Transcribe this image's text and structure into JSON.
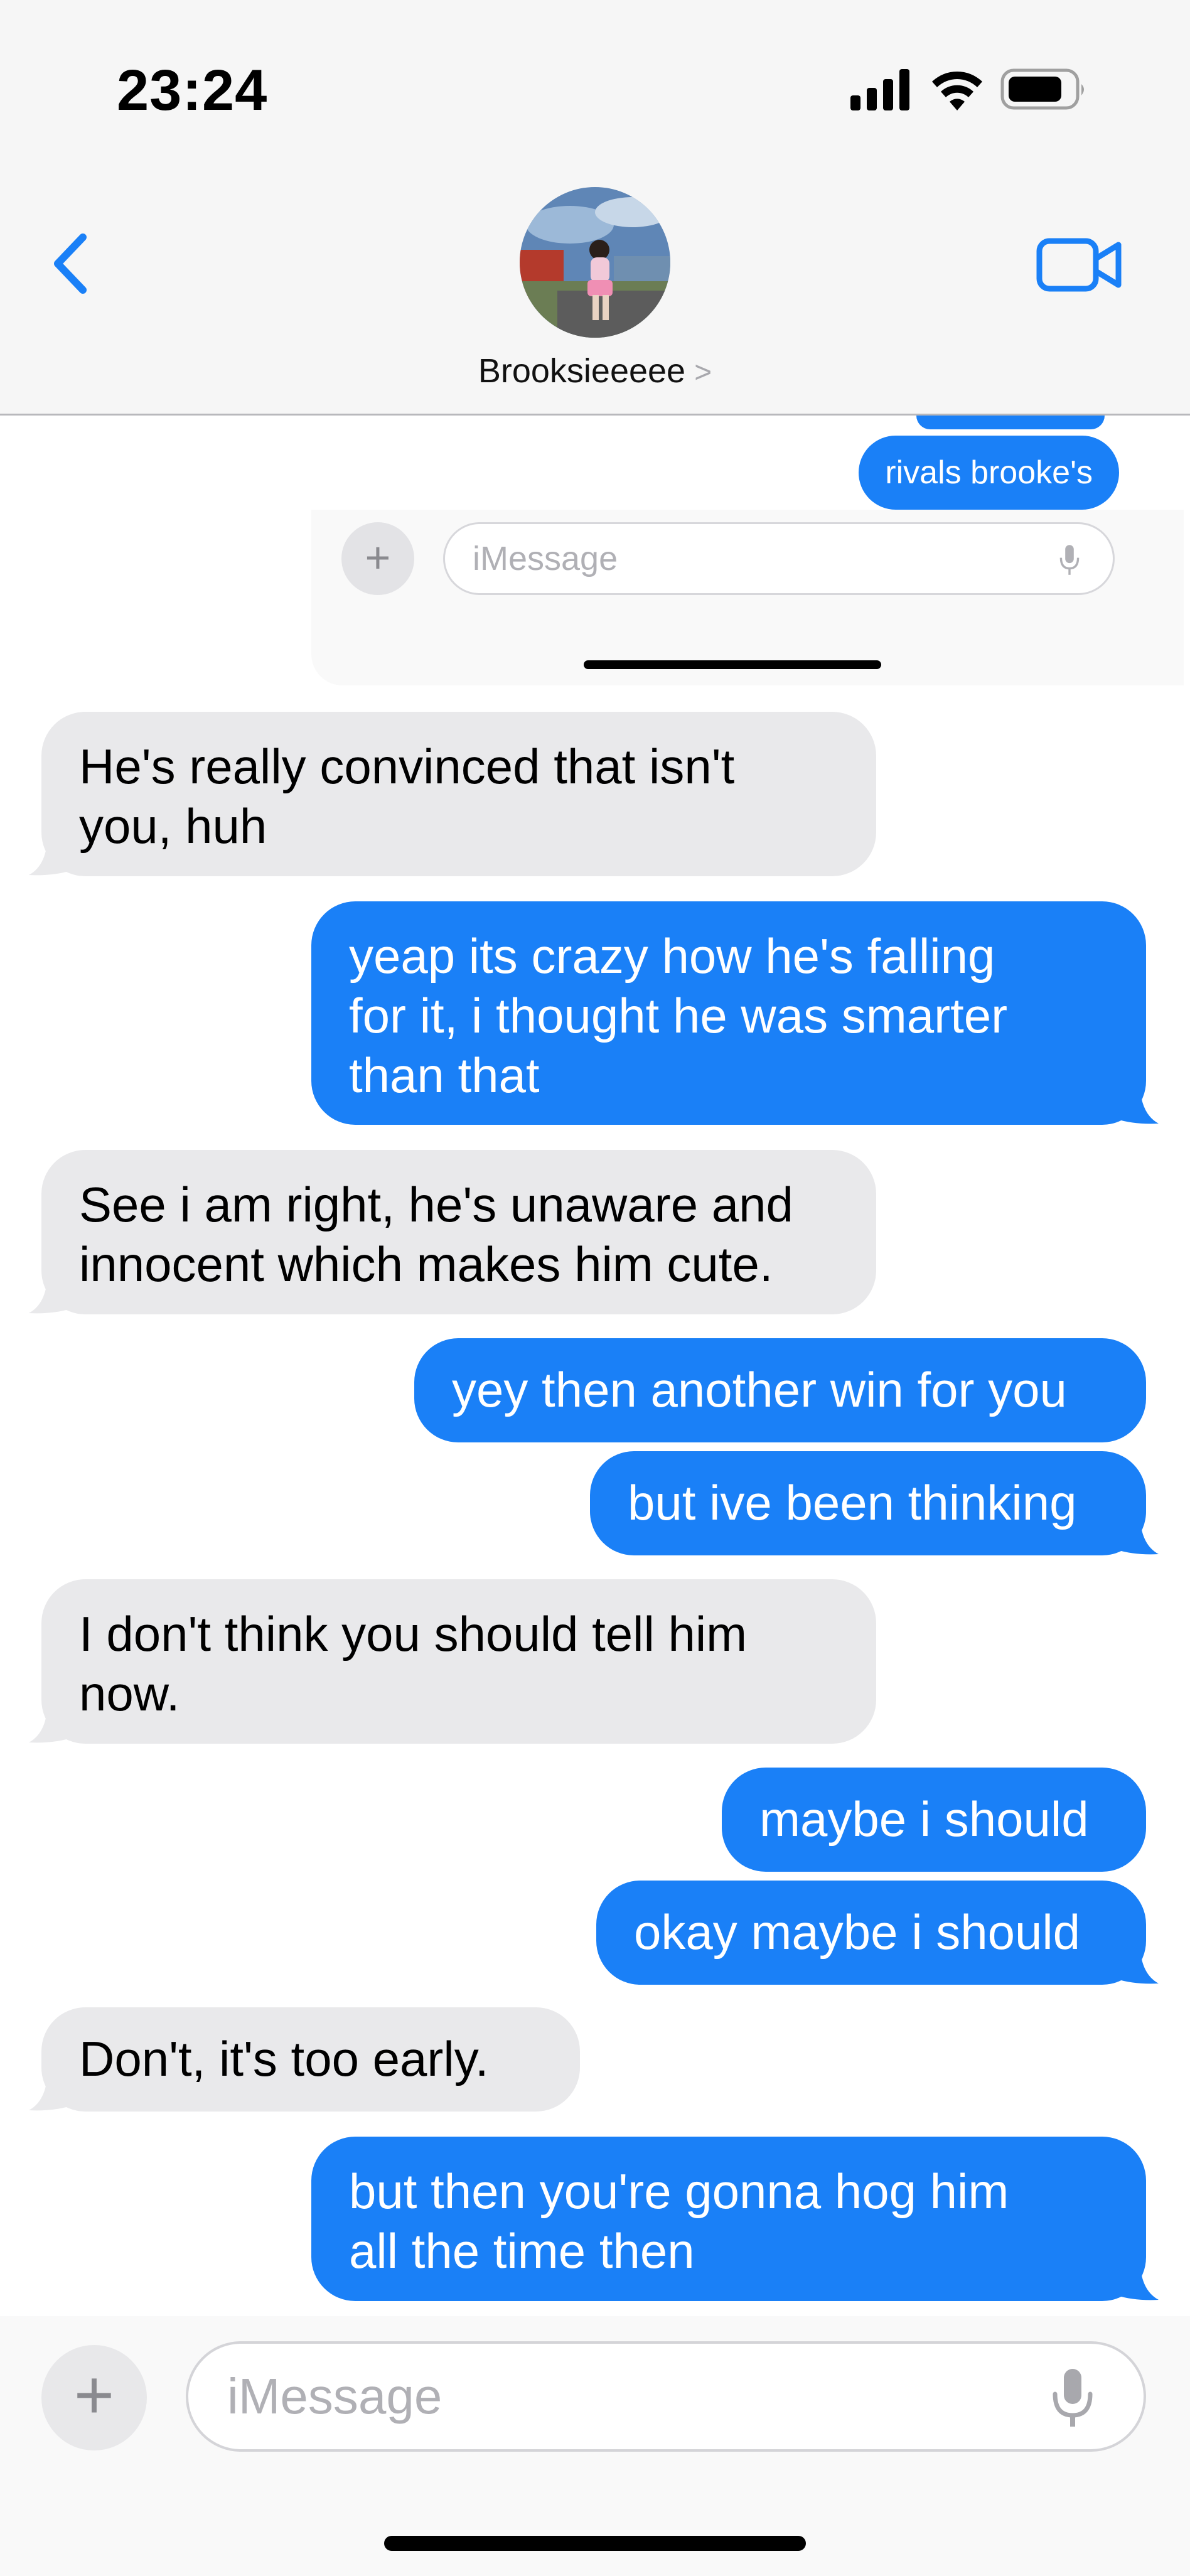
{
  "status_bar": {
    "time": "23:24",
    "icons": [
      "cellular-signal-icon",
      "wifi-icon",
      "battery-icon"
    ]
  },
  "header": {
    "contact_name": "Brooksieeeee",
    "chevron": ">",
    "back_icon": "chevron-left-icon",
    "video_icon": "video-camera-icon"
  },
  "embedded_screenshot": {
    "last_bubble": "rivals brooke's",
    "input_placeholder": "iMessage",
    "plus": "+"
  },
  "messages": [
    {
      "side": "incoming",
      "text": [
        "He's really convinced that isn't",
        "you, huh"
      ]
    },
    {
      "side": "outgoing",
      "text": [
        "yeap its crazy how he's falling",
        "for it, i thought he was smarter",
        "than that"
      ]
    },
    {
      "side": "incoming",
      "text": [
        "See i am right, he's unaware and",
        "innocent which makes him cute."
      ]
    },
    {
      "side": "outgoing",
      "text": [
        "yey then another win for you"
      ]
    },
    {
      "side": "outgoing",
      "text": [
        "but ive been thinking"
      ]
    },
    {
      "side": "incoming",
      "text": [
        "I don't think you should tell him",
        "now."
      ]
    },
    {
      "side": "outgoing",
      "text": [
        "maybe i should"
      ]
    },
    {
      "side": "outgoing",
      "text": [
        "okay maybe i should"
      ]
    },
    {
      "side": "incoming",
      "text": [
        "Don't, it's too early."
      ]
    },
    {
      "side": "outgoing",
      "text": [
        "but then you're gonna hog him",
        "all the time then"
      ]
    }
  ],
  "composer": {
    "placeholder": "iMessage",
    "plus": "+",
    "mic_icon": "microphone-icon"
  },
  "colors": {
    "outgoing_bubble": "#1a80f7",
    "incoming_bubble": "#e9e9eb",
    "accent": "#1a80f7"
  }
}
